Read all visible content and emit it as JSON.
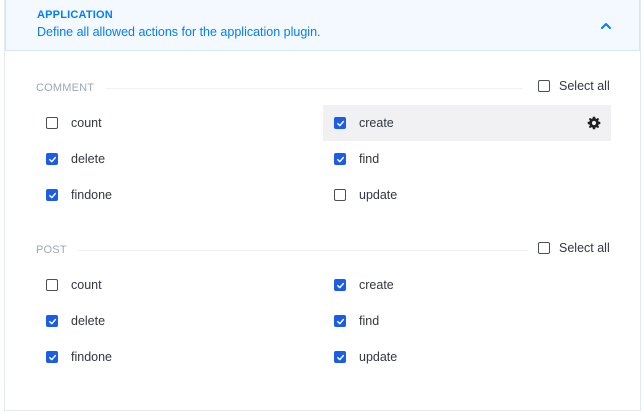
{
  "header": {
    "title": "APPLICATION",
    "subtitle": "Define all allowed actions for the application plugin."
  },
  "colors": {
    "accent": "#007eff",
    "checkbox_checked": "#1c5de7",
    "row_highlight": "#f1f1f3"
  },
  "icons": [
    "chevron-up-icon",
    "checkbox-icon",
    "gear-icon"
  ],
  "sections": [
    {
      "title": "COMMENT",
      "select_all_label": "Select all",
      "select_all_checked": false,
      "actions": [
        {
          "label": "count",
          "checked": false
        },
        {
          "label": "create",
          "checked": true,
          "highlighted": true,
          "has_settings": true
        },
        {
          "label": "delete",
          "checked": true
        },
        {
          "label": "find",
          "checked": true
        },
        {
          "label": "findone",
          "checked": true
        },
        {
          "label": "update",
          "checked": false
        }
      ]
    },
    {
      "title": "POST",
      "select_all_label": "Select all",
      "select_all_checked": false,
      "actions": [
        {
          "label": "count",
          "checked": false
        },
        {
          "label": "create",
          "checked": true
        },
        {
          "label": "delete",
          "checked": true
        },
        {
          "label": "find",
          "checked": true
        },
        {
          "label": "findone",
          "checked": true
        },
        {
          "label": "update",
          "checked": true
        }
      ]
    }
  ]
}
